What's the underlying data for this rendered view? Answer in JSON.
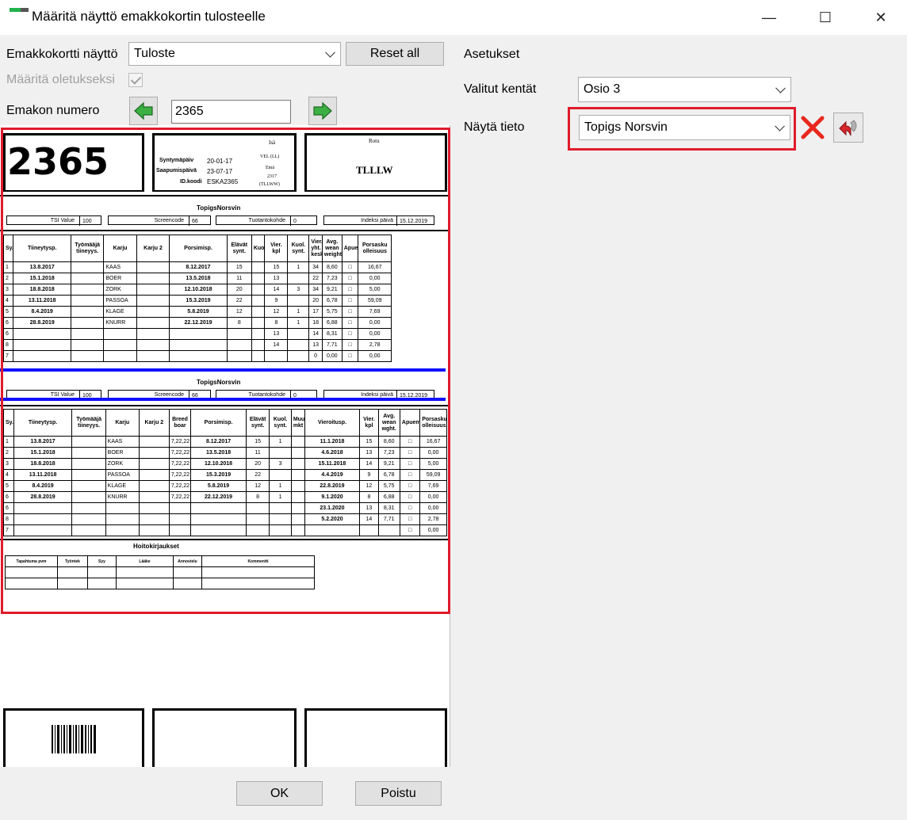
{
  "window": {
    "title": "Määritä näyttö emakkokortin tulosteelle",
    "minimize_glyph": "—",
    "maximize_glyph": "☐",
    "close_glyph": "✕"
  },
  "left": {
    "view_label": "Emakkokortti näyttö",
    "view_value": "Tuloste",
    "reset_label": "Reset all",
    "default_label": "Määritä oletukseksi",
    "sow_number_label": "Emakon numero",
    "sow_number_value": "2365"
  },
  "right": {
    "settings_label": "Asetukset",
    "fields_label": "Valitut kentät",
    "fields_value": "Osio 3",
    "show_label": "Näytä tieto",
    "show_value": "Topigs Norsvin"
  },
  "card": {
    "number": "2365",
    "birth_label": "Syntymäpäiv",
    "birth_value": "20-01-17",
    "arrival_label": "Saapumispäivä",
    "arrival_value": "23-07-17",
    "id_label": "ID.koodi",
    "id_value": "ESKA2365",
    "father_label": "Isä",
    "father_value": "VEL (LL)",
    "mother_label": "Emä",
    "mother_value1": "2317",
    "mother_value2": "(TLLWW)",
    "breed_label": "Rotu",
    "breed_value": "TLLLW"
  },
  "section1": {
    "title": "TopigsNorsvin",
    "tsi_label": "TSI Value",
    "tsi_value": "100",
    "screencode_label": "Screencode",
    "screencode_value": "66",
    "tuotanto_label": "Tuotantokohde",
    "tuotanto_value": "0",
    "index_label": "Indeksi päivä",
    "index_value": "15.12.2019",
    "headers": [
      "Sy.",
      "Tiineytysp.",
      "Työmääjä tiineyys.",
      "Karju",
      "Karju 2",
      "Porsimisp.",
      "Elävät synt.",
      "Kuolleet",
      "Vier. kpl",
      "Kuol. synt.",
      "Vier. yht. keski",
      "Avg. wean weight.",
      "Apuemo",
      "Porsasku olleisuus"
    ],
    "rows": [
      [
        "1",
        "13.8.2017",
        "",
        "KAAS",
        "",
        "8.12.2017",
        "15",
        "",
        "15",
        "1",
        "34",
        "8,60",
        "□",
        "16,67"
      ],
      [
        "2",
        "15.1.2018",
        "",
        "BOER",
        "",
        "13.5.2018",
        "11",
        "",
        "13",
        "",
        "22",
        "7,23",
        "□",
        "0,00"
      ],
      [
        "3",
        "18.8.2018",
        "",
        "ZORK",
        "",
        "12.10.2018",
        "20",
        "",
        "14",
        "3",
        "34",
        "9,21",
        "□",
        "5,00"
      ],
      [
        "4",
        "13.11.2018",
        "",
        "PASSOA",
        "",
        "15.3.2019",
        "22",
        "",
        "9",
        "",
        "20",
        "6,78",
        "□",
        "59,09"
      ],
      [
        "5",
        "8.4.2019",
        "",
        "KLAGE",
        "",
        "5.8.2019",
        "12",
        "",
        "12",
        "1",
        "17",
        "5,75",
        "□",
        "7,69"
      ],
      [
        "6",
        "28.8.2019",
        "",
        "KNURR",
        "",
        "22.12.2019",
        "8",
        "",
        "8",
        "1",
        "18",
        "6,88",
        "□",
        "0,00"
      ],
      [
        "6",
        "",
        "",
        "",
        "",
        "",
        "",
        "",
        "13",
        "",
        "14",
        "8,31",
        "□",
        "0,00"
      ],
      [
        "8",
        "",
        "",
        "",
        "",
        "",
        "",
        "",
        "14",
        "",
        "13",
        "7,71",
        "□",
        "2,78"
      ],
      [
        "7",
        "",
        "",
        "",
        "",
        "",
        "",
        "",
        "",
        "",
        "0",
        "0,00",
        "□",
        "0,00"
      ]
    ]
  },
  "section2": {
    "title": "TopigsNorsvin",
    "tsi_label": "TSI Value",
    "tsi_value": "100",
    "screencode_label": "Screencode",
    "screencode_value": "66",
    "tuotanto_label": "Tuotantokohde",
    "tuotanto_value": "0",
    "index_label": "Indeksi päivä",
    "index_value": "15.12.2019",
    "headers": [
      "Sy.",
      "Tiineytysp.",
      "Työmääjä tiineyys.",
      "Karju",
      "Karju 2",
      "Breed boar",
      "Porsimisp.",
      "Elävät synt.",
      "Kuol. synt.",
      "Muu mkt",
      "Vieroitusp.",
      "Vier. kpl",
      "Avg. wean wght.",
      "Apuemo",
      "Porsasku olleisuus"
    ],
    "rows": [
      [
        "1",
        "13.8.2017",
        "",
        "KAAS",
        "",
        "7,22,22",
        "8.12.2017",
        "15",
        "1",
        "",
        "11.1.2018",
        "15",
        "8,60",
        "□",
        "16,67"
      ],
      [
        "2",
        "15.1.2018",
        "",
        "BOER",
        "",
        "7,22,22",
        "13.5.2018",
        "11",
        "",
        "",
        "4.6.2018",
        "13",
        "7,23",
        "□",
        "0,00"
      ],
      [
        "3",
        "18.8.2018",
        "",
        "ZORK",
        "",
        "7,22,22",
        "12.10.2018",
        "20",
        "3",
        "",
        "15.11.2018",
        "14",
        "9,21",
        "□",
        "5,00"
      ],
      [
        "4",
        "13.11.2018",
        "",
        "PASSOA",
        "",
        "7,22,22",
        "15.3.2019",
        "22",
        "",
        "",
        "4.4.2019",
        "9",
        "6,78",
        "□",
        "59,09"
      ],
      [
        "5",
        "8.4.2019",
        "",
        "KLAGE",
        "",
        "7,22,22",
        "5.8.2019",
        "12",
        "1",
        "",
        "22.8.2019",
        "12",
        "5,75",
        "□",
        "7,69"
      ],
      [
        "6",
        "28.8.2019",
        "",
        "KNURR",
        "",
        "7,22,22",
        "22.12.2019",
        "8",
        "1",
        "",
        "9.1.2020",
        "8",
        "6,88",
        "□",
        "0,00"
      ],
      [
        "6",
        "",
        "",
        "",
        "",
        "",
        "",
        "",
        "",
        "",
        "23.1.2020",
        "13",
        "8,31",
        "□",
        "0,00"
      ],
      [
        "8",
        "",
        "",
        "",
        "",
        "",
        "",
        "",
        "",
        "",
        "5.2.2020",
        "14",
        "7,71",
        "□",
        "2,78"
      ],
      [
        "7",
        "",
        "",
        "",
        "",
        "",
        "",
        "",
        "",
        "",
        "",
        "",
        "",
        "□",
        "0,00"
      ]
    ]
  },
  "notes": {
    "title": "Hoitokirjaukset",
    "headers": [
      "Tapahtuma pvm",
      "Työntek",
      "Syy",
      "Lääke",
      "Annostelu",
      "Kommentti"
    ]
  },
  "buttons": {
    "ok": "OK",
    "exit": "Poistu"
  }
}
